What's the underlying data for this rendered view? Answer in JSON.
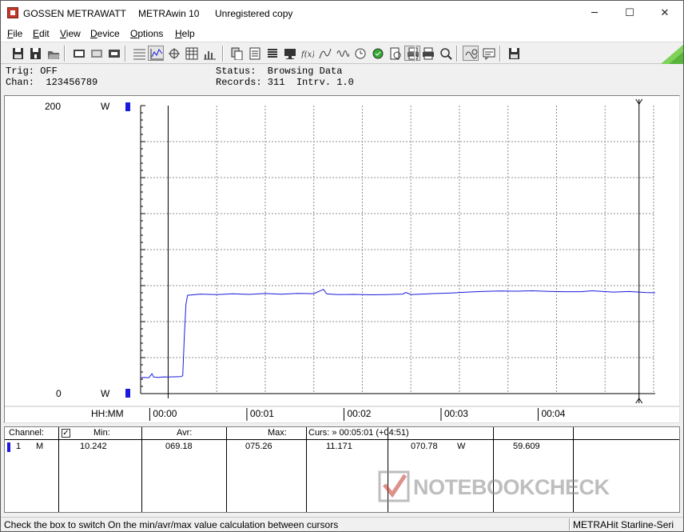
{
  "window": {
    "title_parts": [
      "GOSSEN METRAWATT",
      "METRAwin 10",
      "Unregistered copy"
    ],
    "controls": [
      "─",
      "☐",
      "✕"
    ]
  },
  "menu": [
    {
      "first": "F",
      "rest": "ile"
    },
    {
      "first": "E",
      "rest": "dit"
    },
    {
      "first": "V",
      "rest": "iew"
    },
    {
      "first": "D",
      "rest": "evice"
    },
    {
      "first": "O",
      "rest": "ptions"
    },
    {
      "first": "H",
      "rest": "elp"
    }
  ],
  "toolbar": {
    "icons": [
      "save-icon",
      "save-as-icon",
      "open-folder-icon",
      "device-connect-icon",
      "device-disconnect-icon",
      "device-settings-icon",
      "text-view-icon",
      "waveform-view-icon",
      "crosshair-icon",
      "table-view-icon",
      "histogram-icon",
      "copy-icon",
      "export-icon",
      "list-icon",
      "monitor-icon",
      "fx-icon",
      "math-curve-icon",
      "sine-wave-icon",
      "clock-icon",
      "trigger-icon",
      "print-preview-icon",
      "print-icon",
      "zoom-icon",
      "zoom-reset-icon",
      "comment-icon"
    ]
  },
  "info": {
    "trig": "Trig: OFF",
    "chan": "Chan:  123456789",
    "status": "Status:  Browsing Data",
    "records": "Records: 311  Intrv. 1.0"
  },
  "chart_data": {
    "type": "line",
    "ytop_label": "200",
    "ybottom_label": "0",
    "yunit": "W",
    "ylim": [
      0,
      200
    ],
    "xlabel": "HH:MM",
    "x_ticks": [
      "00:00",
      "00:01",
      "00:02",
      "00:03",
      "00:04"
    ],
    "x_range_seconds": [
      -17,
      301
    ],
    "series": [
      {
        "color": "#1a1adc",
        "points": [
          [
            -17,
            10.9
          ],
          [
            -15,
            11.2
          ],
          [
            -12,
            11.0
          ],
          [
            -10,
            13.8
          ],
          [
            -9,
            11.5
          ],
          [
            -6,
            11.3
          ],
          [
            -3,
            11.6
          ],
          [
            0,
            11.5
          ],
          [
            8,
            11.8
          ],
          [
            9,
            12.5
          ],
          [
            10,
            40.0
          ],
          [
            11,
            62.0
          ],
          [
            12,
            68.3
          ],
          [
            20,
            69.1
          ],
          [
            30,
            68.8
          ],
          [
            40,
            69.3
          ],
          [
            50,
            68.9
          ],
          [
            60,
            69.5
          ],
          [
            70,
            69.0
          ],
          [
            80,
            69.6
          ],
          [
            90,
            69.4
          ],
          [
            96,
            72.4
          ],
          [
            98,
            69.2
          ],
          [
            105,
            68.7
          ],
          [
            115,
            68.9
          ],
          [
            125,
            68.6
          ],
          [
            135,
            68.8
          ],
          [
            145,
            69.1
          ],
          [
            147,
            70.2
          ],
          [
            150,
            68.8
          ],
          [
            165,
            69.5
          ],
          [
            175,
            69.9
          ],
          [
            185,
            70.5
          ],
          [
            195,
            71.0
          ],
          [
            205,
            71.3
          ],
          [
            215,
            71.1
          ],
          [
            225,
            71.4
          ],
          [
            235,
            71.0
          ],
          [
            245,
            70.8
          ],
          [
            255,
            70.8
          ],
          [
            262,
            71.4
          ],
          [
            275,
            70.5
          ],
          [
            285,
            70.9
          ],
          [
            295,
            70.2
          ],
          [
            301,
            70.0
          ]
        ]
      }
    ],
    "grid": true
  },
  "table": {
    "headers": {
      "channel": "Channel:",
      "min": "Min:",
      "avr": "Avr:",
      "max": "Max:",
      "curs": "Curs: » 00:05:01 (+04:51)"
    },
    "checkbox": "✓",
    "row": {
      "chan": "1",
      "mode": "M",
      "min": "10.242",
      "avr": "069.18",
      "max": "075.26",
      "curs1": "11.171",
      "curs2": "070.78",
      "unit": "W",
      "curs3": "59.609"
    }
  },
  "watermark": "NOTEBOOKCHECK",
  "statusbar": {
    "hint": "Check the box to switch On the min/avr/max value calculation between cursors",
    "device": "METRAHit Starline-Seri"
  }
}
